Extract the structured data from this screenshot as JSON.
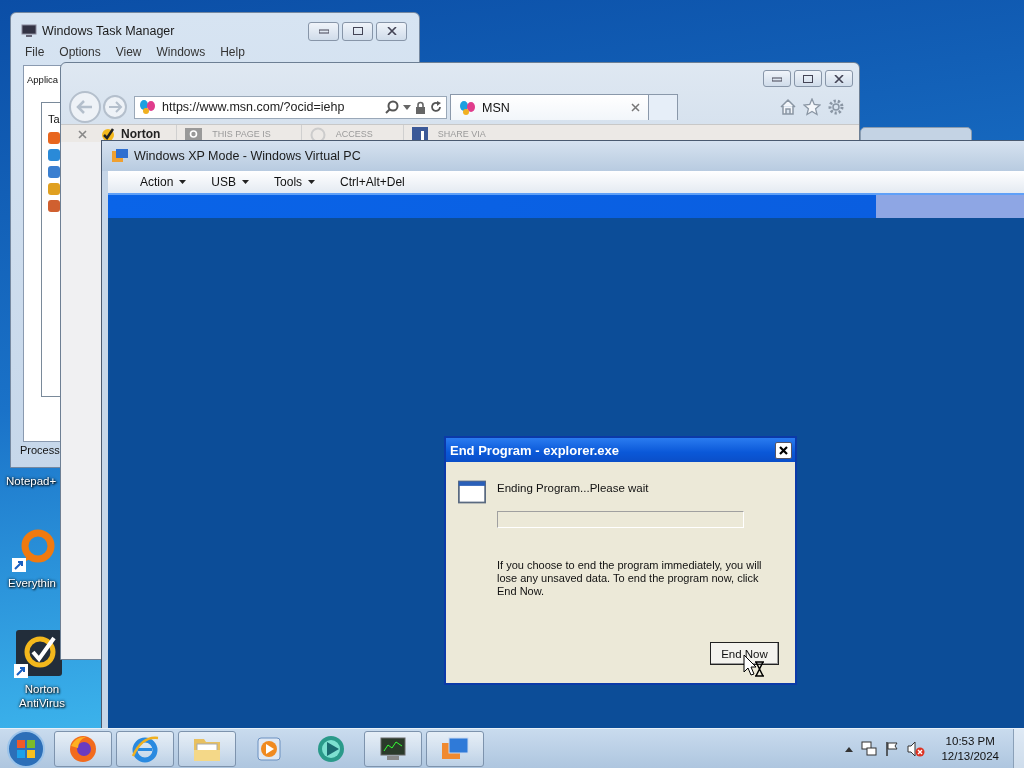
{
  "desktop_icons": [
    {
      "label": "Notepad+"
    },
    {
      "label": "Everythin",
      "kind": "everything"
    },
    {
      "label": "Norton AntiVirus",
      "kind": "norton"
    }
  ],
  "task_manager": {
    "title": "Windows Task Manager",
    "menu": [
      "File",
      "Options",
      "View",
      "Windows",
      "Help"
    ],
    "tab": "Applica",
    "column": "Ta",
    "footer": "Process"
  },
  "browser": {
    "address": "https://www.msn.com/?ocid=iehp",
    "tabs": [
      {
        "label": "MSN",
        "selected": true
      }
    ],
    "toolbar": [
      {
        "kind": "brand",
        "label": "Norton"
      },
      {
        "kind": "help",
        "label": "THIS PAGE IS"
      },
      {
        "kind": "access",
        "label": "ACCESS"
      },
      {
        "kind": "share",
        "label": "SHARE VIA"
      }
    ]
  },
  "vm_window": {
    "title": "Windows XP Mode - Windows Virtual PC",
    "menu": [
      {
        "label": "Action",
        "dropdown": true
      },
      {
        "label": "USB",
        "dropdown": true
      },
      {
        "label": "Tools",
        "dropdown": true
      },
      {
        "label": "Ctrl+Alt+Del",
        "dropdown": false
      }
    ]
  },
  "dialog": {
    "title": "End Program - explorer.exe",
    "status": "Ending Program...Please wait",
    "progress": {
      "level": 0
    },
    "message": "If you choose to end the program immediately, you will lose any unsaved data. To end the program now, click End Now.",
    "button": "End Now"
  },
  "taskbar": {
    "apps": [
      {
        "kind": "firefox",
        "running": true
      },
      {
        "kind": "ie",
        "running": true
      },
      {
        "kind": "explorer",
        "running": true
      },
      {
        "kind": "media",
        "running": false
      },
      {
        "kind": "gem",
        "running": false
      },
      {
        "kind": "taskmgr",
        "running": true
      },
      {
        "kind": "vpc",
        "running": true
      }
    ],
    "clock": {
      "time": "10:53 PM",
      "date": "12/13/2024"
    }
  }
}
